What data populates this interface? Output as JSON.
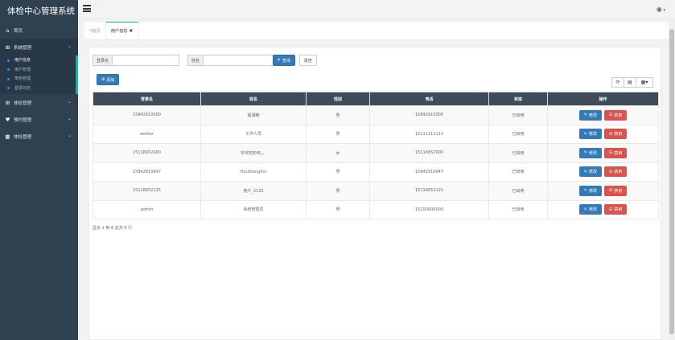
{
  "app": {
    "title": "体检中心管理系统"
  },
  "sidebar": {
    "items": [
      {
        "icon": "home-icon",
        "label": "首页"
      },
      {
        "icon": "windows-icon",
        "label": "系统管理"
      },
      {
        "icon": "plus-square-icon",
        "label": "体检管理"
      },
      {
        "icon": "heartbeat-icon",
        "label": "预约管理"
      },
      {
        "icon": "calendar-icon",
        "label": "体检管理"
      }
    ],
    "subitems": [
      "用户信息",
      "用户管理",
      "角色管理",
      "登录日志"
    ]
  },
  "tabs": [
    {
      "label": "首页",
      "icon": "home-icon"
    },
    {
      "label": "用户信息",
      "icon": "close-circle-icon"
    }
  ],
  "search": {
    "login_label": "登录名",
    "name_label": "姓名",
    "search_btn": "查询",
    "reset_btn": "清空"
  },
  "add_btn": "添加",
  "table": {
    "columns": [
      "登录名",
      "姓名",
      "性别",
      "电话",
      "状态",
      "操作"
    ],
    "rows": [
      [
        "15842910000",
        "程湘楠",
        "男",
        "15842910000",
        "已启用"
      ],
      [
        "worker",
        "工作人员",
        "男",
        "15111111111",
        "已启用"
      ],
      [
        "15116652000",
        "爷爷奶奶呵。。",
        "女",
        "15116652000",
        "已启用"
      ],
      [
        "15842910647",
        "HouXiangXui",
        "男",
        "15842910647",
        "已启用"
      ],
      [
        "15116652125",
        "用户_2125",
        "男",
        "15116652125",
        "已启用"
      ],
      [
        "admin",
        "系统管理员",
        "男",
        "15100000000",
        "已启用"
      ]
    ],
    "edit_label": "修改",
    "disable_label": "禁用"
  },
  "pager": {
    "info": "显示 1 到 6 总共 6 行"
  }
}
